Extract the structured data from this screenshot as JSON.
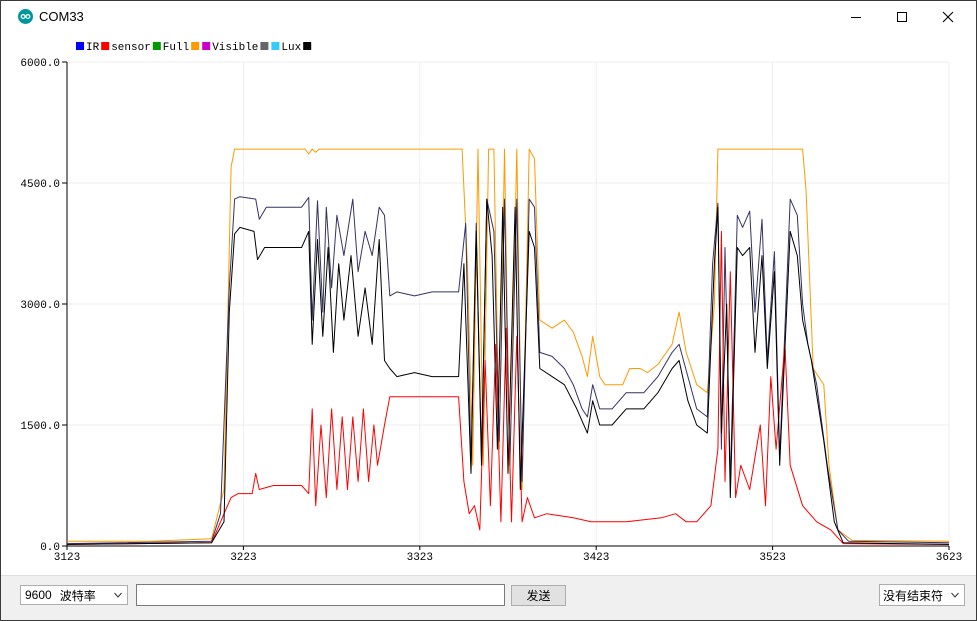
{
  "window": {
    "title": "COM33"
  },
  "app_icon": "arduino-logo-icon",
  "window_controls": {
    "minimize": "minimize-icon",
    "maximize": "maximize-icon",
    "close": "close-icon"
  },
  "legend": [
    {
      "label": "IR",
      "color": "#0000ff"
    },
    {
      "label": "sensor",
      "color": "#ff0000"
    },
    {
      "label": "Full",
      "color": "#009900"
    },
    {
      "label": "",
      "color": "#ff9900"
    },
    {
      "label": "Visible",
      "color": "#cc00cc"
    },
    {
      "label": "",
      "color": "#666666"
    },
    {
      "label": "Lux",
      "color": "#33ccff"
    },
    {
      "label": "",
      "color": "#000000"
    }
  ],
  "bottom": {
    "baud_value": "9600",
    "baud_label": "波特率",
    "input_value": "",
    "send_label": "发送",
    "line_ending": "没有结束符"
  },
  "chart_data": {
    "type": "line",
    "xlim": [
      3123,
      3623
    ],
    "ylim": [
      0,
      6000
    ],
    "x_ticks": [
      "3123",
      "3223",
      "3323",
      "3423",
      "3523",
      "3623"
    ],
    "y_ticks": [
      "0.0",
      "1500.0",
      "3000.0",
      "4500.0",
      "6000.0"
    ],
    "grid": true,
    "legend_position": "top-left",
    "series": [
      {
        "color": "#ff9900",
        "points": [
          [
            3123,
            60
          ],
          [
            3170,
            60
          ],
          [
            3205,
            90
          ],
          [
            3212,
            700
          ],
          [
            3216,
            4700
          ],
          [
            3218,
            4920
          ],
          [
            3258,
            4920
          ],
          [
            3260,
            4860
          ],
          [
            3262,
            4920
          ],
          [
            3264,
            4880
          ],
          [
            3266,
            4920
          ],
          [
            3347,
            4920
          ],
          [
            3350,
            3500
          ],
          [
            3353,
            1000
          ],
          [
            3356,
            4920
          ],
          [
            3359,
            1000
          ],
          [
            3362,
            4920
          ],
          [
            3365,
            4920
          ],
          [
            3368,
            1200
          ],
          [
            3371,
            4920
          ],
          [
            3374,
            900
          ],
          [
            3378,
            4920
          ],
          [
            3381,
            700
          ],
          [
            3385,
            4920
          ],
          [
            3388,
            4800
          ],
          [
            3391,
            2800
          ],
          [
            3398,
            2700
          ],
          [
            3405,
            2800
          ],
          [
            3410,
            2650
          ],
          [
            3415,
            2350
          ],
          [
            3418,
            2100
          ],
          [
            3421,
            2600
          ],
          [
            3425,
            2100
          ],
          [
            3428,
            2000
          ],
          [
            3438,
            2000
          ],
          [
            3442,
            2200
          ],
          [
            3448,
            2200
          ],
          [
            3452,
            2150
          ],
          [
            3458,
            2250
          ],
          [
            3466,
            2500
          ],
          [
            3470,
            2900
          ],
          [
            3474,
            2400
          ],
          [
            3480,
            2000
          ],
          [
            3486,
            1900
          ],
          [
            3490,
            3000
          ],
          [
            3492,
            4920
          ],
          [
            3540,
            4920
          ],
          [
            3542,
            4400
          ],
          [
            3546,
            2200
          ],
          [
            3552,
            2000
          ],
          [
            3555,
            1000
          ],
          [
            3560,
            200
          ],
          [
            3568,
            70
          ],
          [
            3623,
            60
          ]
        ]
      },
      {
        "color": "#333366",
        "points": [
          [
            3123,
            30
          ],
          [
            3205,
            60
          ],
          [
            3210,
            400
          ],
          [
            3215,
            3200
          ],
          [
            3218,
            4300
          ],
          [
            3221,
            4330
          ],
          [
            3230,
            4300
          ],
          [
            3232,
            4050
          ],
          [
            3236,
            4200
          ],
          [
            3256,
            4200
          ],
          [
            3260,
            4320
          ],
          [
            3262,
            2800
          ],
          [
            3265,
            4280
          ],
          [
            3268,
            2900
          ],
          [
            3270,
            4200
          ],
          [
            3273,
            3200
          ],
          [
            3276,
            4100
          ],
          [
            3280,
            3600
          ],
          [
            3285,
            4300
          ],
          [
            3288,
            3400
          ],
          [
            3292,
            3900
          ],
          [
            3296,
            3600
          ],
          [
            3300,
            4200
          ],
          [
            3303,
            4100
          ],
          [
            3306,
            3100
          ],
          [
            3310,
            3150
          ],
          [
            3320,
            3100
          ],
          [
            3330,
            3150
          ],
          [
            3345,
            3150
          ],
          [
            3349,
            4000
          ],
          [
            3352,
            1000
          ],
          [
            3355,
            4000
          ],
          [
            3358,
            1100
          ],
          [
            3361,
            4300
          ],
          [
            3365,
            3900
          ],
          [
            3368,
            1300
          ],
          [
            3371,
            4300
          ],
          [
            3374,
            1000
          ],
          [
            3378,
            4300
          ],
          [
            3381,
            800
          ],
          [
            3385,
            4300
          ],
          [
            3388,
            4200
          ],
          [
            3391,
            2400
          ],
          [
            3398,
            2350
          ],
          [
            3405,
            2200
          ],
          [
            3410,
            2000
          ],
          [
            3415,
            1700
          ],
          [
            3418,
            1600
          ],
          [
            3421,
            2000
          ],
          [
            3425,
            1700
          ],
          [
            3432,
            1700
          ],
          [
            3440,
            1900
          ],
          [
            3450,
            1900
          ],
          [
            3458,
            2100
          ],
          [
            3466,
            2400
          ],
          [
            3470,
            2500
          ],
          [
            3475,
            2100
          ],
          [
            3480,
            1700
          ],
          [
            3486,
            1600
          ],
          [
            3489,
            3500
          ],
          [
            3492,
            4250
          ],
          [
            3494,
            1200
          ],
          [
            3496,
            3700
          ],
          [
            3499,
            800
          ],
          [
            3503,
            4100
          ],
          [
            3506,
            3950
          ],
          [
            3510,
            4150
          ],
          [
            3513,
            2900
          ],
          [
            3517,
            4050
          ],
          [
            3520,
            2300
          ],
          [
            3524,
            3650
          ],
          [
            3527,
            1100
          ],
          [
            3533,
            4300
          ],
          [
            3537,
            4100
          ],
          [
            3540,
            3000
          ],
          [
            3543,
            2500
          ],
          [
            3548,
            2000
          ],
          [
            3554,
            1000
          ],
          [
            3560,
            200
          ],
          [
            3566,
            60
          ],
          [
            3623,
            40
          ]
        ]
      },
      {
        "color": "#ff0000",
        "points": [
          [
            3123,
            20
          ],
          [
            3205,
            40
          ],
          [
            3212,
            400
          ],
          [
            3216,
            600
          ],
          [
            3220,
            650
          ],
          [
            3228,
            650
          ],
          [
            3230,
            900
          ],
          [
            3232,
            700
          ],
          [
            3240,
            750
          ],
          [
            3256,
            750
          ],
          [
            3260,
            650
          ],
          [
            3262,
            1700
          ],
          [
            3264,
            500
          ],
          [
            3267,
            1500
          ],
          [
            3270,
            600
          ],
          [
            3273,
            1700
          ],
          [
            3276,
            700
          ],
          [
            3279,
            1600
          ],
          [
            3282,
            700
          ],
          [
            3285,
            1600
          ],
          [
            3288,
            800
          ],
          [
            3291,
            1700
          ],
          [
            3294,
            800
          ],
          [
            3297,
            1500
          ],
          [
            3299,
            1000
          ],
          [
            3303,
            1500
          ],
          [
            3306,
            1850
          ],
          [
            3310,
            1850
          ],
          [
            3330,
            1850
          ],
          [
            3345,
            1850
          ],
          [
            3348,
            800
          ],
          [
            3351,
            400
          ],
          [
            3354,
            500
          ],
          [
            3357,
            200
          ],
          [
            3360,
            2300
          ],
          [
            3363,
            500
          ],
          [
            3366,
            2500
          ],
          [
            3369,
            300
          ],
          [
            3372,
            2700
          ],
          [
            3375,
            300
          ],
          [
            3378,
            2600
          ],
          [
            3381,
            300
          ],
          [
            3384,
            600
          ],
          [
            3388,
            350
          ],
          [
            3395,
            400
          ],
          [
            3410,
            350
          ],
          [
            3420,
            300
          ],
          [
            3440,
            300
          ],
          [
            3460,
            350
          ],
          [
            3468,
            400
          ],
          [
            3474,
            300
          ],
          [
            3480,
            300
          ],
          [
            3488,
            500
          ],
          [
            3492,
            1200
          ],
          [
            3494,
            3900
          ],
          [
            3496,
            800
          ],
          [
            3499,
            3400
          ],
          [
            3502,
            600
          ],
          [
            3505,
            1000
          ],
          [
            3510,
            700
          ],
          [
            3516,
            1500
          ],
          [
            3519,
            500
          ],
          [
            3522,
            2100
          ],
          [
            3525,
            1200
          ],
          [
            3530,
            2500
          ],
          [
            3533,
            1000
          ],
          [
            3540,
            500
          ],
          [
            3548,
            300
          ],
          [
            3556,
            200
          ],
          [
            3563,
            30
          ],
          [
            3623,
            20
          ]
        ]
      },
      {
        "color": "#000000",
        "points": [
          [
            3123,
            20
          ],
          [
            3205,
            40
          ],
          [
            3212,
            300
          ],
          [
            3215,
            2900
          ],
          [
            3218,
            3870
          ],
          [
            3221,
            3950
          ],
          [
            3229,
            3900
          ],
          [
            3231,
            3550
          ],
          [
            3235,
            3700
          ],
          [
            3256,
            3700
          ],
          [
            3260,
            3900
          ],
          [
            3262,
            2500
          ],
          [
            3265,
            3800
          ],
          [
            3268,
            2600
          ],
          [
            3271,
            3700
          ],
          [
            3274,
            2400
          ],
          [
            3277,
            3500
          ],
          [
            3280,
            2800
          ],
          [
            3284,
            3600
          ],
          [
            3288,
            2600
          ],
          [
            3292,
            3200
          ],
          [
            3296,
            2500
          ],
          [
            3300,
            3800
          ],
          [
            3303,
            2300
          ],
          [
            3306,
            2200
          ],
          [
            3310,
            2100
          ],
          [
            3320,
            2150
          ],
          [
            3330,
            2100
          ],
          [
            3345,
            2100
          ],
          [
            3348,
            3500
          ],
          [
            3352,
            900
          ],
          [
            3355,
            3900
          ],
          [
            3358,
            1000
          ],
          [
            3361,
            4300
          ],
          [
            3364,
            3600
          ],
          [
            3367,
            1200
          ],
          [
            3370,
            4200
          ],
          [
            3373,
            900
          ],
          [
            3377,
            4200
          ],
          [
            3380,
            700
          ],
          [
            3385,
            3900
          ],
          [
            3388,
            3700
          ],
          [
            3391,
            2200
          ],
          [
            3398,
            2100
          ],
          [
            3405,
            2000
          ],
          [
            3412,
            1700
          ],
          [
            3418,
            1400
          ],
          [
            3421,
            1800
          ],
          [
            3425,
            1500
          ],
          [
            3432,
            1500
          ],
          [
            3440,
            1700
          ],
          [
            3450,
            1700
          ],
          [
            3458,
            1900
          ],
          [
            3466,
            2200
          ],
          [
            3470,
            2300
          ],
          [
            3475,
            1800
          ],
          [
            3480,
            1500
          ],
          [
            3486,
            1400
          ],
          [
            3490,
            3500
          ],
          [
            3492,
            4200
          ],
          [
            3494,
            1400
          ],
          [
            3497,
            3000
          ],
          [
            3499,
            600
          ],
          [
            3503,
            3700
          ],
          [
            3506,
            3600
          ],
          [
            3510,
            3700
          ],
          [
            3513,
            2400
          ],
          [
            3517,
            3600
          ],
          [
            3520,
            2200
          ],
          [
            3524,
            3400
          ],
          [
            3527,
            1000
          ],
          [
            3533,
            3900
          ],
          [
            3537,
            3600
          ],
          [
            3540,
            2800
          ],
          [
            3545,
            2300
          ],
          [
            3552,
            1300
          ],
          [
            3558,
            300
          ],
          [
            3563,
            40
          ],
          [
            3623,
            20
          ]
        ]
      }
    ]
  }
}
